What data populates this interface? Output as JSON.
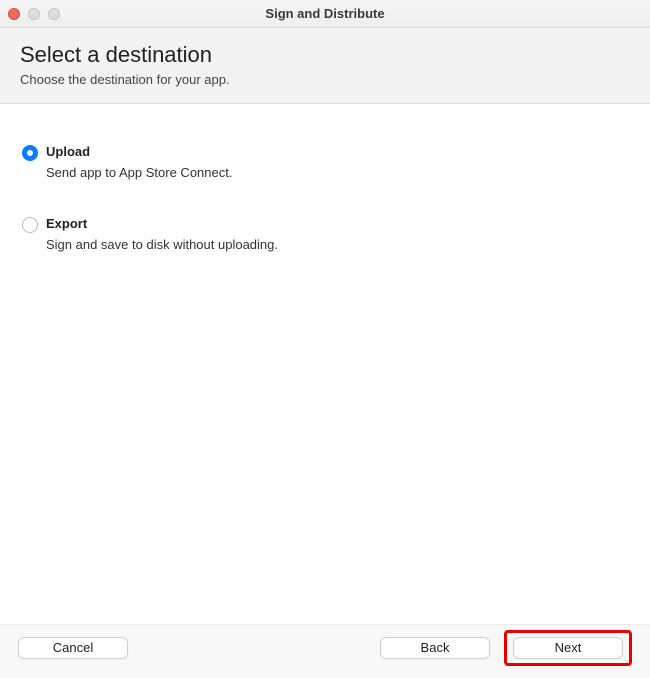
{
  "window": {
    "title": "Sign and Distribute"
  },
  "header": {
    "heading": "Select a destination",
    "subheading": "Choose the destination for your app."
  },
  "options": {
    "upload": {
      "title": "Upload",
      "description": "Send app to App Store Connect."
    },
    "export": {
      "title": "Export",
      "description": "Sign and save to disk without uploading."
    }
  },
  "footer": {
    "cancel": "Cancel",
    "back": "Back",
    "next": "Next"
  }
}
